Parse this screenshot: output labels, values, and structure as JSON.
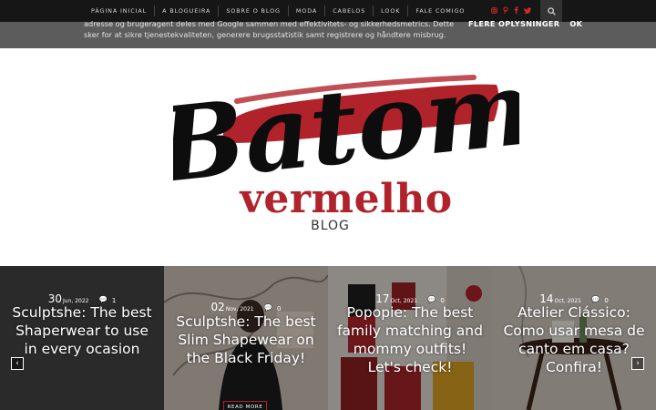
{
  "nav": {
    "items": [
      "PÁGINA INICIAL",
      "A BLOGUEIRA",
      "SOBRE O BLOG",
      "MODA",
      "CABELOS",
      "LOOK",
      "FALE COMIGO"
    ],
    "social_icons": [
      "instagram-icon",
      "pinterest-icon",
      "facebook-icon",
      "twitter-icon"
    ],
    "accent_color": "#cf2a2a"
  },
  "cookie": {
    "text": "adresse og brugeragent deles med Google sammen med effektivitets- og sikkerhedsmetrics. Dette sker for at sikre tjenestekvaliteten, generere brugsstatistik samt registrere og håndtere misbrug.",
    "more_label": "FLERE OPLYSNINGER",
    "ok_label": "OK"
  },
  "logo": {
    "script": "Batom",
    "name": "vermelho",
    "sub": "BLOG",
    "brand_color": "#b1232b"
  },
  "slides": [
    {
      "day": "30",
      "month_year": "Jun, 2022",
      "comments": "1",
      "title": "Sculptshe: The best Shaperwear to use in every ocasion"
    },
    {
      "day": "02",
      "month_year": "Nov, 2021",
      "comments": "0",
      "title": "Sculptshe: The best Slim Shapewear on the Black Friday!"
    },
    {
      "day": "17",
      "month_year": "Oct, 2021",
      "comments": "0",
      "title": "Popopie: The best family matching and mommy outfits! Let's check!"
    },
    {
      "day": "14",
      "month_year": "Oct, 2021",
      "comments": "0",
      "title": "Atelier Clássico: Como usar mesa de canto em casa? Confira!"
    }
  ],
  "read_more_label": "READ MORE"
}
